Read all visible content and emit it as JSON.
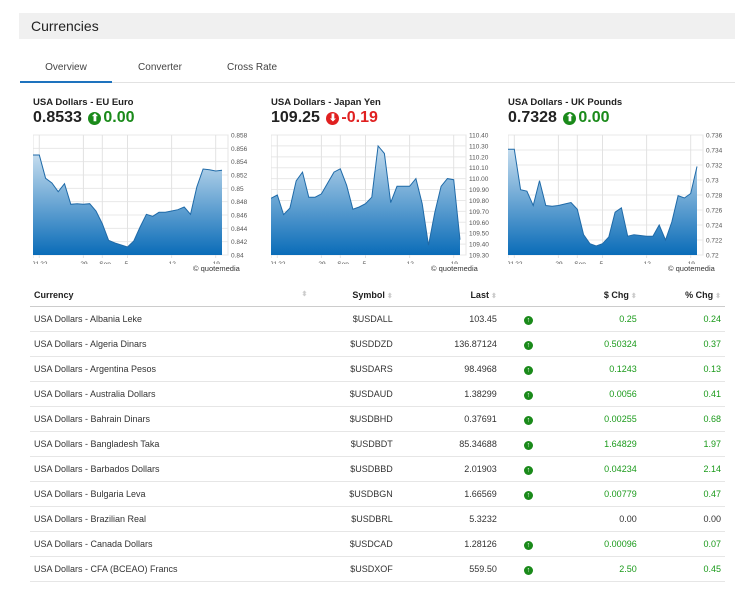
{
  "header": {
    "title": "Currencies"
  },
  "tabs": [
    {
      "label": "Overview",
      "active": true
    },
    {
      "label": "Converter"
    },
    {
      "label": "Cross Rate"
    }
  ],
  "colors": {
    "up": "#1a8a1a",
    "down": "#e02020",
    "area_top": "#c4dcee",
    "area_bottom": "#0a6cb8",
    "line": "#1f6aa8",
    "tab_accent": "#1e73be"
  },
  "attribution": "© quotemedia",
  "chart_data": [
    {
      "type": "area",
      "title": "USA Dollars - EU Euro",
      "last": "0.8533",
      "change": "0.00",
      "direction": "up",
      "ylim": [
        0.84,
        0.858
      ],
      "yticks": [
        "0.858",
        "0.856",
        "0.854",
        "0.852",
        "0.85",
        "0.848",
        "0.846",
        "0.844",
        "0.842",
        "0.84"
      ],
      "xticks": [
        {
          "label": "21",
          "date": "Aug 21"
        },
        {
          "label": "22",
          "date": "Aug 22"
        },
        {
          "label": "29",
          "date": "Aug 29"
        },
        {
          "label": "Sep",
          "date": "Sep 1"
        },
        {
          "label": "5",
          "date": "Sep 5"
        },
        {
          "label": "12",
          "date": "Sep 12"
        },
        {
          "label": "19",
          "date": "Sep 19"
        }
      ],
      "grid": true,
      "values": [
        0.855,
        0.855,
        0.8515,
        0.8508,
        0.8495,
        0.8507,
        0.8476,
        0.8477,
        0.8476,
        0.8477,
        0.8466,
        0.8447,
        0.8422,
        0.8418,
        0.8415,
        0.8412,
        0.8421,
        0.8442,
        0.8461,
        0.8458,
        0.8464,
        0.8464,
        0.8466,
        0.8468,
        0.8472,
        0.8461,
        0.8502,
        0.8529,
        0.8528,
        0.8526,
        0.8527
      ]
    },
    {
      "type": "area",
      "title": "USA Dollars - Japan Yen",
      "last": "109.25",
      "change": "-0.19",
      "direction": "down",
      "ylim": [
        109.3,
        110.4
      ],
      "yticks": [
        "110.40",
        "110.30",
        "110.20",
        "110.10",
        "110.00",
        "109.90",
        "109.80",
        "109.70",
        "109.60",
        "109.50",
        "109.40",
        "109.30"
      ],
      "xticks": [
        {
          "label": "21",
          "date": "Aug 21"
        },
        {
          "label": "22",
          "date": "Aug 22"
        },
        {
          "label": "29",
          "date": "Aug 29"
        },
        {
          "label": "Sep",
          "date": "Sep 1"
        },
        {
          "label": "5",
          "date": "Sep 5"
        },
        {
          "label": "12",
          "date": "Sep 12"
        },
        {
          "label": "19",
          "date": "Sep 19"
        }
      ],
      "grid": true,
      "values": [
        109.82,
        109.85,
        109.67,
        109.73,
        109.98,
        110.06,
        109.83,
        109.83,
        109.86,
        109.96,
        110.06,
        110.09,
        109.94,
        109.72,
        109.74,
        109.77,
        109.83,
        110.3,
        110.23,
        109.78,
        109.93,
        109.93,
        109.93,
        110.0,
        109.77,
        109.39,
        109.69,
        109.93,
        110.0,
        109.99,
        109.44
      ]
    },
    {
      "type": "area",
      "title": "USA Dollars - UK Pounds",
      "last": "0.7328",
      "change": "0.00",
      "direction": "up",
      "ylim": [
        0.72,
        0.736
      ],
      "yticks": [
        "0.736",
        "0.734",
        "0.732",
        "0.73",
        "0.728",
        "0.726",
        "0.724",
        "0.722",
        "0.72"
      ],
      "xticks": [
        {
          "label": "21",
          "date": "Aug 21"
        },
        {
          "label": "22",
          "date": "Aug 22"
        },
        {
          "label": "29",
          "date": "Aug 29"
        },
        {
          "label": "Sep",
          "date": "Sep 1"
        },
        {
          "label": "5",
          "date": "Sep 5"
        },
        {
          "label": "12",
          "date": "Sep 12"
        },
        {
          "label": "19",
          "date": "Sep 19"
        }
      ],
      "grid": true,
      "values": [
        0.7341,
        0.7341,
        0.7287,
        0.7285,
        0.7266,
        0.7299,
        0.7266,
        0.7265,
        0.7266,
        0.7268,
        0.727,
        0.7261,
        0.7227,
        0.7215,
        0.7212,
        0.7215,
        0.7224,
        0.7257,
        0.7263,
        0.7225,
        0.7227,
        0.7226,
        0.7225,
        0.7225,
        0.724,
        0.722,
        0.7244,
        0.7279,
        0.7276,
        0.7282,
        0.7318
      ]
    }
  ],
  "table": {
    "columns": [
      "Currency",
      "Symbol",
      "Last",
      "",
      "$ Chg",
      "% Chg"
    ],
    "rows": [
      {
        "currency": "USA Dollars - Albania Leke",
        "symbol": "$USDALL",
        "last": "103.45",
        "dir": "up",
        "chg": "0.25",
        "pct": "0.24"
      },
      {
        "currency": "USA Dollars - Algeria Dinars",
        "symbol": "$USDDZD",
        "last": "136.87124",
        "dir": "up",
        "chg": "0.50324",
        "pct": "0.37"
      },
      {
        "currency": "USA Dollars - Argentina Pesos",
        "symbol": "$USDARS",
        "last": "98.4968",
        "dir": "up",
        "chg": "0.1243",
        "pct": "0.13"
      },
      {
        "currency": "USA Dollars - Australia Dollars",
        "symbol": "$USDAUD",
        "last": "1.38299",
        "dir": "up",
        "chg": "0.0056",
        "pct": "0.41"
      },
      {
        "currency": "USA Dollars - Bahrain Dinars",
        "symbol": "$USDBHD",
        "last": "0.37691",
        "dir": "up",
        "chg": "0.00255",
        "pct": "0.68"
      },
      {
        "currency": "USA Dollars - Bangladesh Taka",
        "symbol": "$USDBDT",
        "last": "85.34688",
        "dir": "up",
        "chg": "1.64829",
        "pct": "1.97"
      },
      {
        "currency": "USA Dollars - Barbados Dollars",
        "symbol": "$USDBBD",
        "last": "2.01903",
        "dir": "up",
        "chg": "0.04234",
        "pct": "2.14"
      },
      {
        "currency": "USA Dollars - Bulgaria Leva",
        "symbol": "$USDBGN",
        "last": "1.66569",
        "dir": "up",
        "chg": "0.00779",
        "pct": "0.47"
      },
      {
        "currency": "USA Dollars - Brazilian Real",
        "symbol": "$USDBRL",
        "last": "5.3232",
        "dir": "",
        "chg": "0.00",
        "pct": "0.00"
      },
      {
        "currency": "USA Dollars - Canada Dollars",
        "symbol": "$USDCAD",
        "last": "1.28126",
        "dir": "up",
        "chg": "0.00096",
        "pct": "0.07"
      },
      {
        "currency": "USA Dollars - CFA (BCEAO) Francs",
        "symbol": "$USDXOF",
        "last": "559.50",
        "dir": "up",
        "chg": "2.50",
        "pct": "0.45"
      }
    ]
  }
}
